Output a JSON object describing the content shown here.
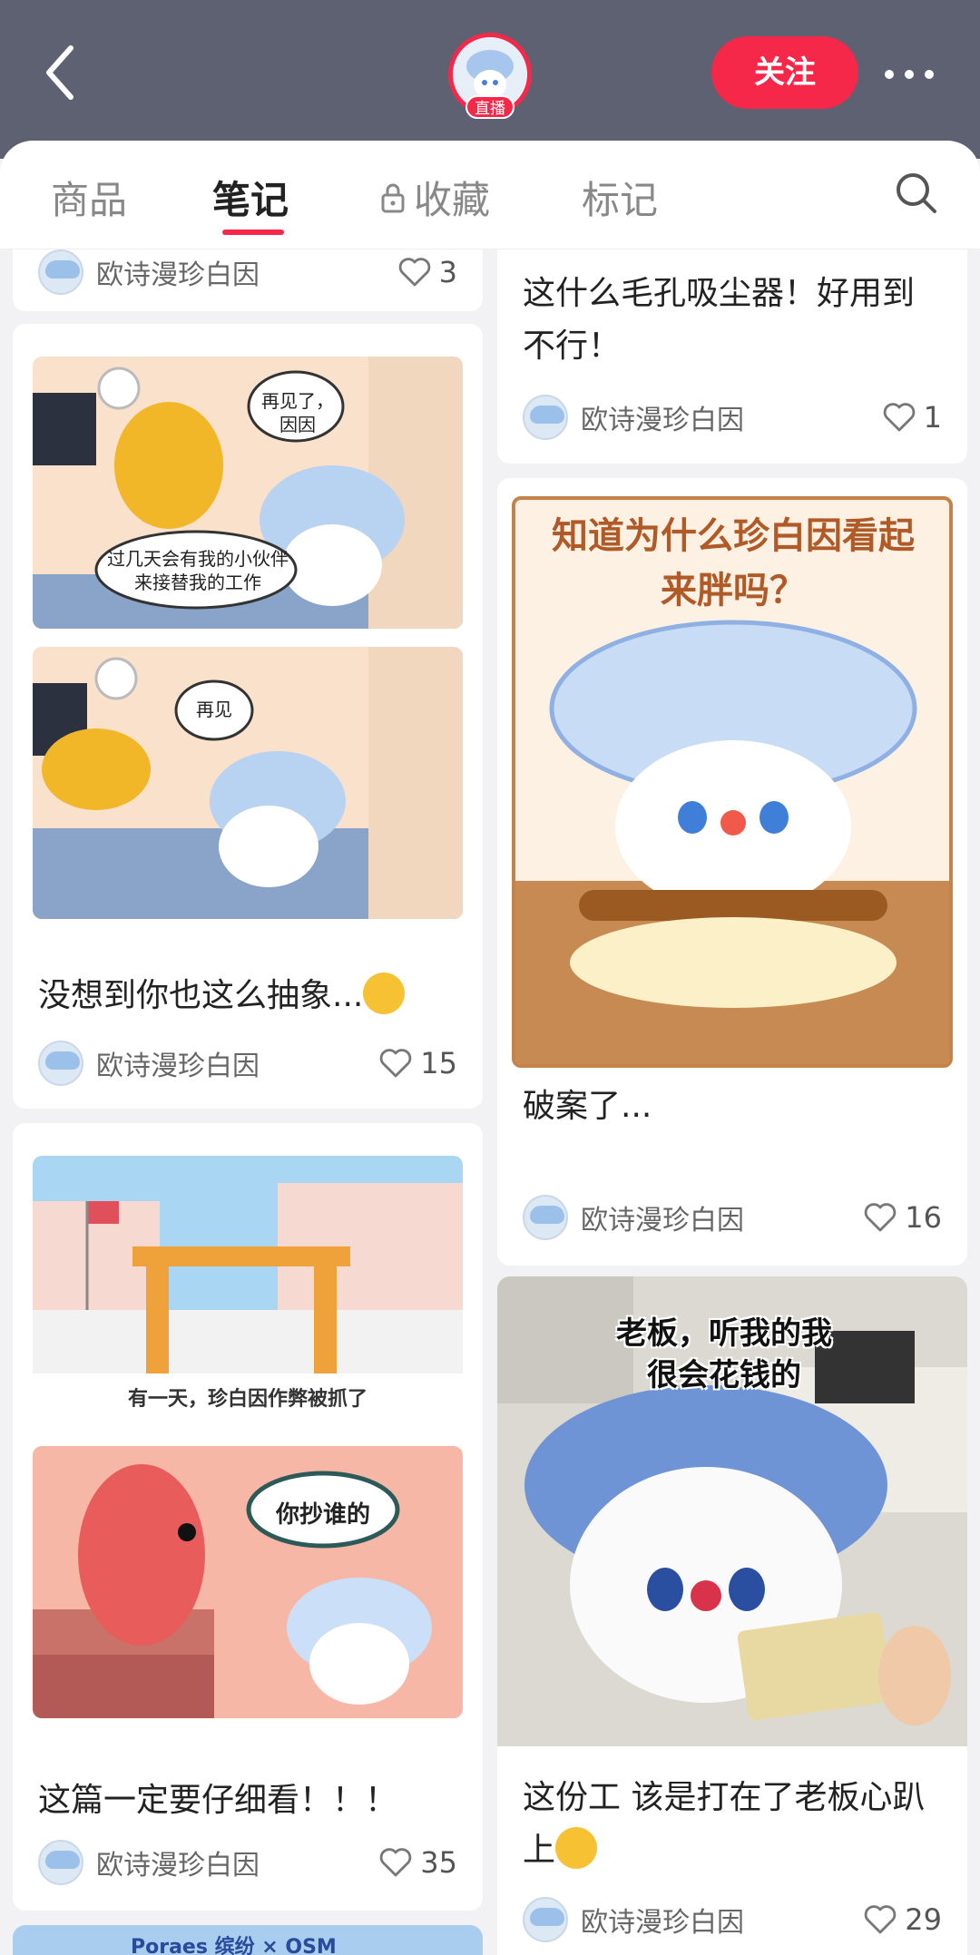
{
  "header": {
    "live_badge": "直播",
    "follow_label": "关注"
  },
  "tabs": [
    {
      "label": "商品"
    },
    {
      "label": "笔记"
    },
    {
      "label": "收藏"
    },
    {
      "label": "标记"
    }
  ],
  "author_name": "欧诗漫珍白因",
  "cards": [
    {
      "title": "",
      "likes": "3"
    },
    {
      "title": "这什么毛孔吸尘器！好用到不行！",
      "likes": "1"
    },
    {
      "title": "没想到你也这么抽象...",
      "likes": "15",
      "panel1_bubble_a": "再见了，因因",
      "panel1_bubble_b": "过几天会有我的小伙伴来接替我的工作",
      "panel2_bubble": "再见"
    },
    {
      "title": "破案了...",
      "likes": "16",
      "image_caption": "知道为什么珍白因看起来胖吗？"
    },
    {
      "title": "这篇一定要仔细看！！！",
      "likes": "35",
      "panel1_caption": "有一天，珍白因作弊被抓了",
      "panel2_bubble": "你抄谁的"
    },
    {
      "title": "这份工 该是打在了老板心趴上",
      "likes": "29",
      "image_caption": "老板，听我的我很会花钱的"
    }
  ],
  "bottom_peek_text": "Poraes 缤纷 × OSM",
  "colors": {
    "accent": "#f5284a",
    "header_bg": "#5e6172",
    "page_bg": "#f2f2f4"
  },
  "icons": [
    "back-icon",
    "more-icon",
    "lock-icon",
    "search-icon",
    "heart-icon",
    "grin-emoji-icon"
  ]
}
